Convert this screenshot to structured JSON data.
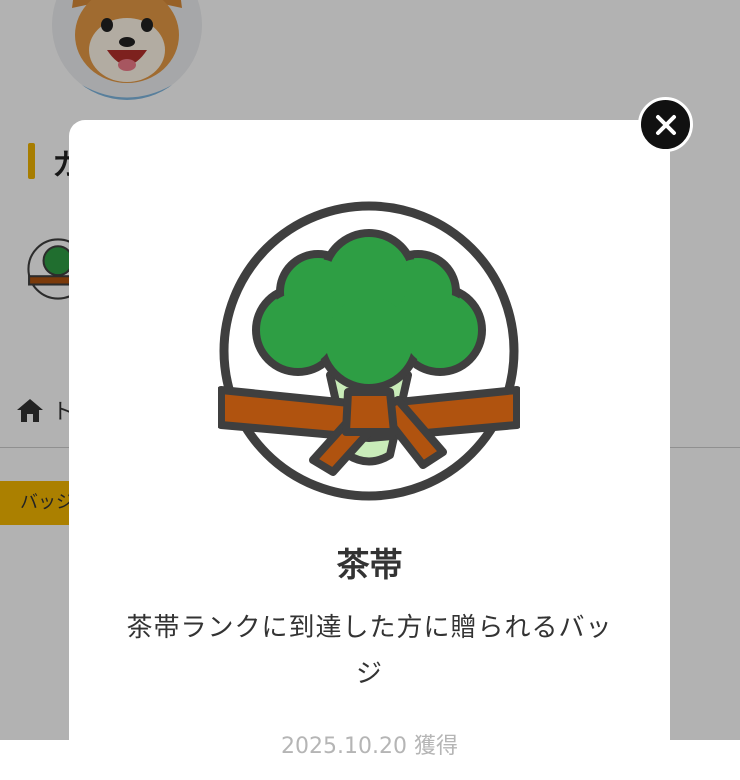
{
  "background": {
    "section_title": "カ",
    "breadcrumb": {
      "label": "ト"
    },
    "tag_label": "バッジ"
  },
  "modal": {
    "close_icon": "close-icon",
    "badge_icon": "broccoli-brown-belt-icon",
    "badge_title": "茶帯",
    "badge_description": "茶帯ランクに到達した方に贈られるバッジ",
    "acquired_date": "2025.10.20 獲得"
  },
  "colors": {
    "accent": "#f0b400",
    "broccoli_green": "#2e9e44",
    "belt_brown": "#b0530f",
    "outline": "#3f3f3f"
  }
}
